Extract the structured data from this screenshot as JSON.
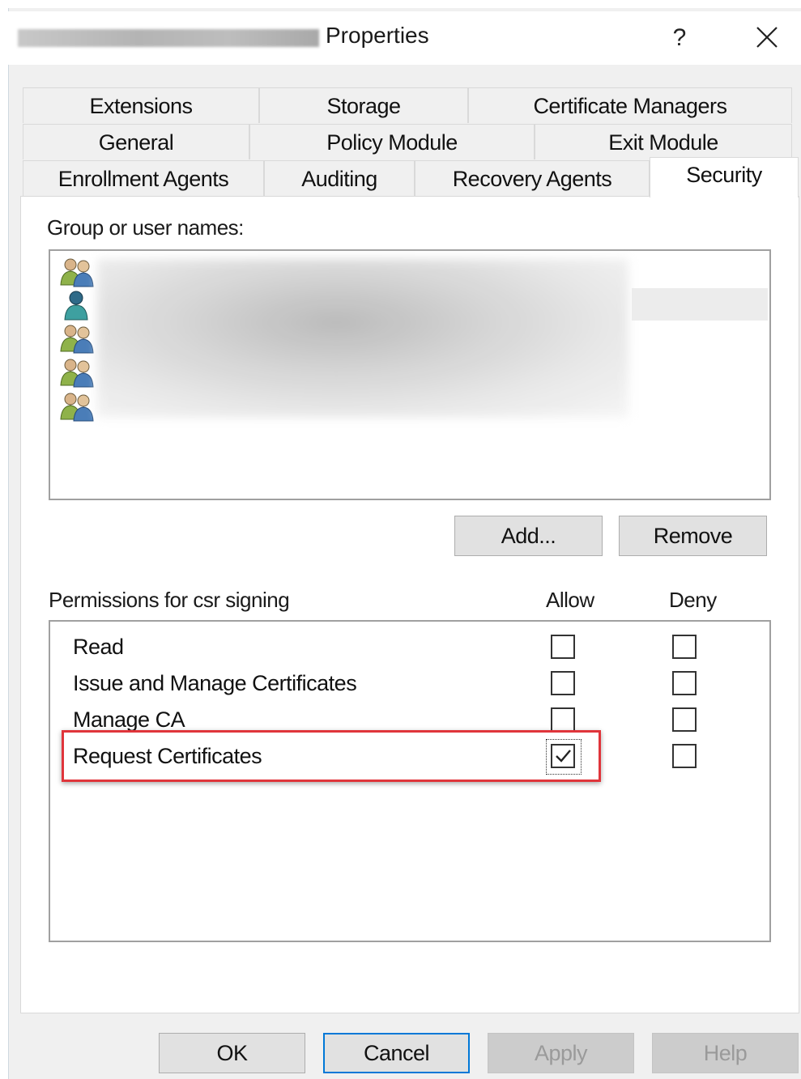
{
  "window": {
    "title": "Properties",
    "help_glyph": "?",
    "close_icon": "close-icon"
  },
  "tabs": {
    "row1": [
      "Extensions",
      "Storage",
      "Certificate Managers"
    ],
    "row2": [
      "General",
      "Policy Module",
      "Exit Module"
    ],
    "row3": [
      "Enrollment Agents",
      "Auditing",
      "Recovery Agents",
      "Security"
    ],
    "active": "Security"
  },
  "security": {
    "group_label": "Group or user names:",
    "users": [
      {
        "icon": "group-icon",
        "selected": false
      },
      {
        "icon": "user-icon",
        "selected": true
      },
      {
        "icon": "group-icon",
        "selected": false
      },
      {
        "icon": "group-icon",
        "selected": false
      },
      {
        "icon": "group-icon",
        "selected": false
      }
    ],
    "add_label": "Add...",
    "remove_label": "Remove",
    "permissions_label": "Permissions for csr signing",
    "allow_header": "Allow",
    "deny_header": "Deny",
    "permissions": [
      {
        "name": "Read",
        "allow": false,
        "deny": false
      },
      {
        "name": "Issue and Manage Certificates",
        "allow": false,
        "deny": false
      },
      {
        "name": "Manage CA",
        "allow": false,
        "deny": false
      },
      {
        "name": "Request Certificates",
        "allow": true,
        "deny": false
      }
    ],
    "highlight_color": "#e0353b"
  },
  "footer": {
    "ok": "OK",
    "cancel": "Cancel",
    "apply": "Apply",
    "help": "Help"
  }
}
